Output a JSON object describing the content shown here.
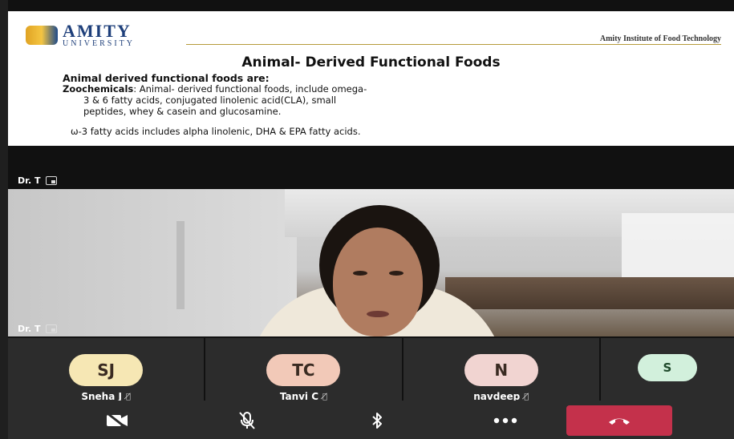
{
  "slide": {
    "logo_main": "AMITY",
    "logo_sub": "UNIVERSITY",
    "institute": "Amity Institute of Food Technology",
    "title": "Animal- Derived Functional Foods",
    "subtitle": "Animal derived functional foods are:",
    "para_lead": "Zoochemicals",
    "para_line1": ": Animal- derived functional foods, include omega-",
    "para_line2": "3 & 6 fatty acids, conjugated linolenic acid(CLA), small",
    "para_line3": "peptides, whey & casein and glucosamine.",
    "omega_line": "ω-3 fatty  acids includes alpha linolenic, DHA & EPA fatty acids."
  },
  "presenter": {
    "name": "Dr. T"
  },
  "participants": [
    {
      "initials": "SJ",
      "name": "Sneha J",
      "color": "#f6e7b4"
    },
    {
      "initials": "TC",
      "name": "Tanvi C",
      "color": "#f2c9b8"
    },
    {
      "initials": "N",
      "name": "navdeep",
      "color": "#f1d4d1"
    },
    {
      "initials": "S",
      "name": "",
      "color": "#d2f0dc"
    }
  ],
  "toolbar": {
    "hangup_color": "#c4314b"
  }
}
